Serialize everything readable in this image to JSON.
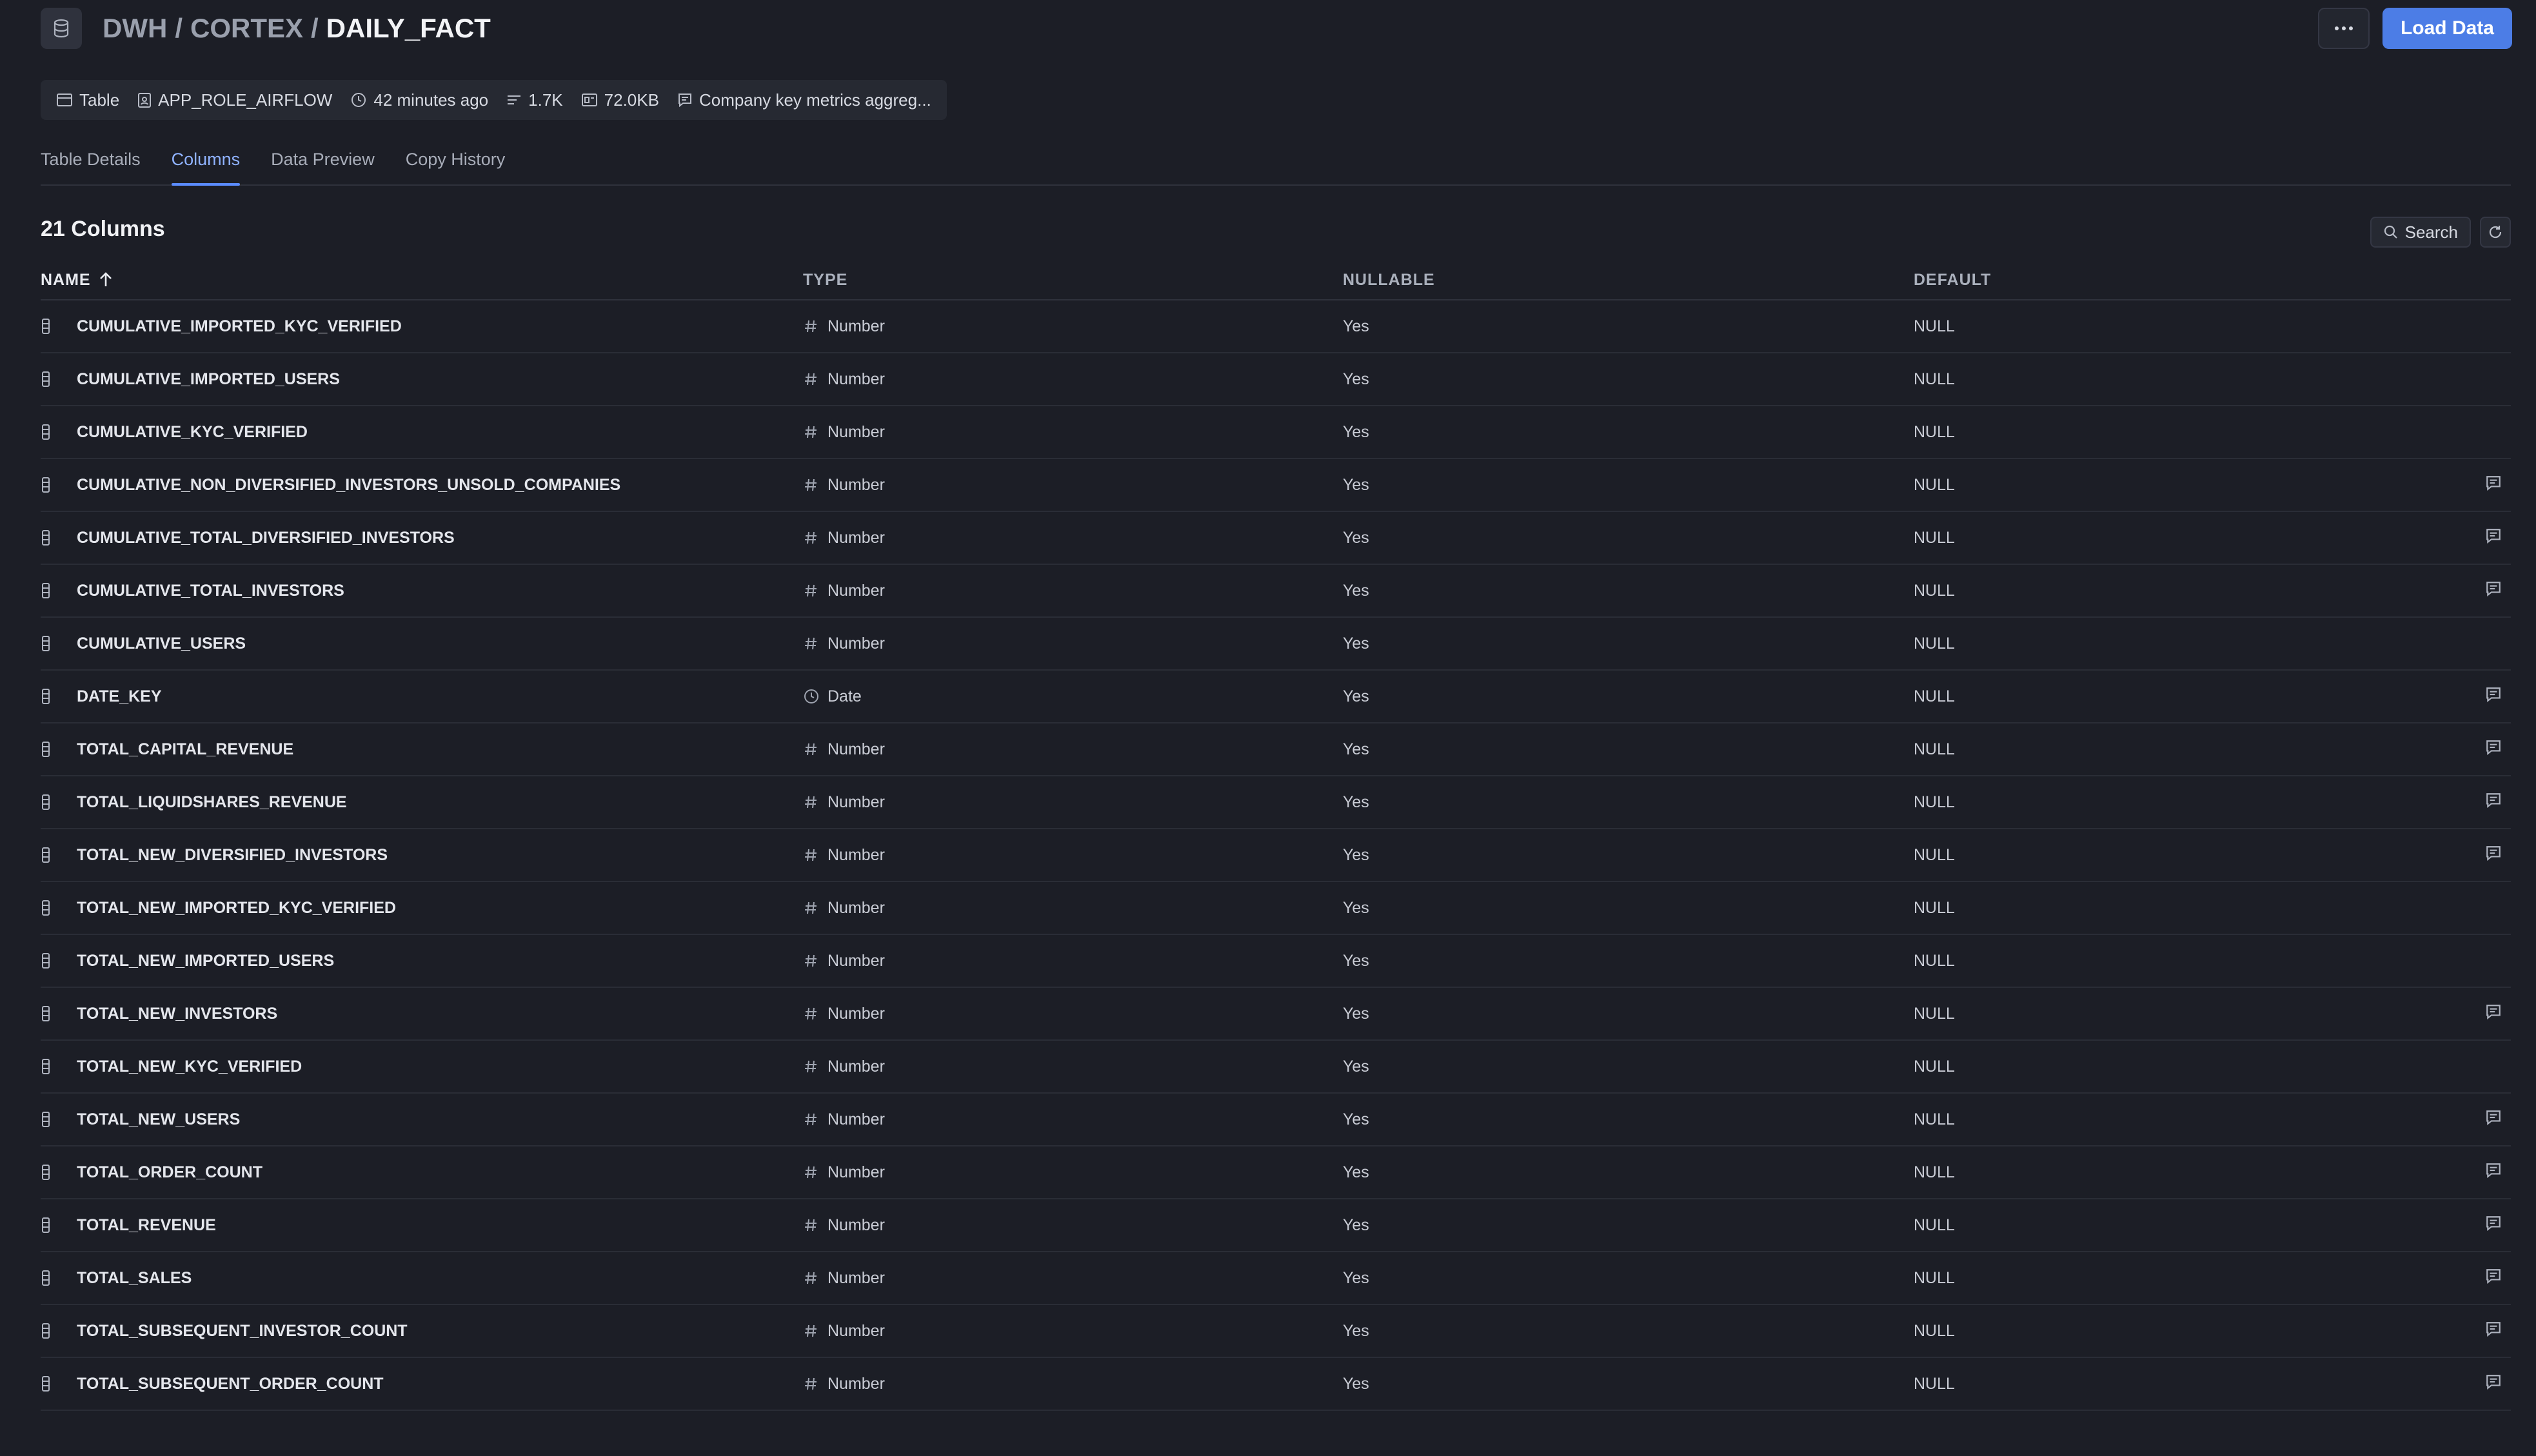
{
  "breadcrumb": {
    "part1": "DWH",
    "sep1": "/",
    "part2": "CORTEX",
    "sep2": "/",
    "current": "DAILY_FACT"
  },
  "header": {
    "more_label": "···",
    "load_button": "Load Data"
  },
  "meta": {
    "type": "Table",
    "owner": "APP_ROLE_AIRFLOW",
    "updated": "42 minutes ago",
    "rows": "1.7K",
    "size": "72.0KB",
    "comment": "Company key metrics aggreg..."
  },
  "tabs": [
    "Table Details",
    "Columns",
    "Data Preview",
    "Copy History"
  ],
  "active_tab": "Columns",
  "section": {
    "title": "21 Columns",
    "search_label": "Search"
  },
  "table": {
    "headers": {
      "name": "NAME",
      "type": "TYPE",
      "nullable": "NULLABLE",
      "default": "DEFAULT"
    },
    "sort": "ascending",
    "rows": [
      {
        "name": "CUMULATIVE_IMPORTED_KYC_VERIFIED",
        "type": "Number",
        "type_icon": "hash-icon",
        "nullable": "Yes",
        "default": "NULL",
        "has_comment": false
      },
      {
        "name": "CUMULATIVE_IMPORTED_USERS",
        "type": "Number",
        "type_icon": "hash-icon",
        "nullable": "Yes",
        "default": "NULL",
        "has_comment": false
      },
      {
        "name": "CUMULATIVE_KYC_VERIFIED",
        "type": "Number",
        "type_icon": "hash-icon",
        "nullable": "Yes",
        "default": "NULL",
        "has_comment": false
      },
      {
        "name": "CUMULATIVE_NON_DIVERSIFIED_INVESTORS_UNSOLD_COMPANIES",
        "type": "Number",
        "type_icon": "hash-icon",
        "nullable": "Yes",
        "default": "NULL",
        "has_comment": true
      },
      {
        "name": "CUMULATIVE_TOTAL_DIVERSIFIED_INVESTORS",
        "type": "Number",
        "type_icon": "hash-icon",
        "nullable": "Yes",
        "default": "NULL",
        "has_comment": true
      },
      {
        "name": "CUMULATIVE_TOTAL_INVESTORS",
        "type": "Number",
        "type_icon": "hash-icon",
        "nullable": "Yes",
        "default": "NULL",
        "has_comment": true
      },
      {
        "name": "CUMULATIVE_USERS",
        "type": "Number",
        "type_icon": "hash-icon",
        "nullable": "Yes",
        "default": "NULL",
        "has_comment": false
      },
      {
        "name": "DATE_KEY",
        "type": "Date",
        "type_icon": "clock-icon",
        "nullable": "Yes",
        "default": "NULL",
        "has_comment": true
      },
      {
        "name": "TOTAL_CAPITAL_REVENUE",
        "type": "Number",
        "type_icon": "hash-icon",
        "nullable": "Yes",
        "default": "NULL",
        "has_comment": true
      },
      {
        "name": "TOTAL_LIQUIDSHARES_REVENUE",
        "type": "Number",
        "type_icon": "hash-icon",
        "nullable": "Yes",
        "default": "NULL",
        "has_comment": true
      },
      {
        "name": "TOTAL_NEW_DIVERSIFIED_INVESTORS",
        "type": "Number",
        "type_icon": "hash-icon",
        "nullable": "Yes",
        "default": "NULL",
        "has_comment": true
      },
      {
        "name": "TOTAL_NEW_IMPORTED_KYC_VERIFIED",
        "type": "Number",
        "type_icon": "hash-icon",
        "nullable": "Yes",
        "default": "NULL",
        "has_comment": false
      },
      {
        "name": "TOTAL_NEW_IMPORTED_USERS",
        "type": "Number",
        "type_icon": "hash-icon",
        "nullable": "Yes",
        "default": "NULL",
        "has_comment": false
      },
      {
        "name": "TOTAL_NEW_INVESTORS",
        "type": "Number",
        "type_icon": "hash-icon",
        "nullable": "Yes",
        "default": "NULL",
        "has_comment": true
      },
      {
        "name": "TOTAL_NEW_KYC_VERIFIED",
        "type": "Number",
        "type_icon": "hash-icon",
        "nullable": "Yes",
        "default": "NULL",
        "has_comment": false
      },
      {
        "name": "TOTAL_NEW_USERS",
        "type": "Number",
        "type_icon": "hash-icon",
        "nullable": "Yes",
        "default": "NULL",
        "has_comment": true
      },
      {
        "name": "TOTAL_ORDER_COUNT",
        "type": "Number",
        "type_icon": "hash-icon",
        "nullable": "Yes",
        "default": "NULL",
        "has_comment": true
      },
      {
        "name": "TOTAL_REVENUE",
        "type": "Number",
        "type_icon": "hash-icon",
        "nullable": "Yes",
        "default": "NULL",
        "has_comment": true
      },
      {
        "name": "TOTAL_SALES",
        "type": "Number",
        "type_icon": "hash-icon",
        "nullable": "Yes",
        "default": "NULL",
        "has_comment": true
      },
      {
        "name": "TOTAL_SUBSEQUENT_INVESTOR_COUNT",
        "type": "Number",
        "type_icon": "hash-icon",
        "nullable": "Yes",
        "default": "NULL",
        "has_comment": true
      },
      {
        "name": "TOTAL_SUBSEQUENT_ORDER_COUNT",
        "type": "Number",
        "type_icon": "hash-icon",
        "nullable": "Yes",
        "default": "NULL",
        "has_comment": true
      }
    ]
  },
  "colors": {
    "background": "#1c1e26",
    "accent": "#4c7de6",
    "active_tab": "#8fb2ff"
  }
}
